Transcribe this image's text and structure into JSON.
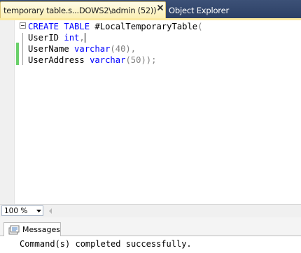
{
  "tabs": {
    "active_label": "temporary table.s...DOWS2\\admin (52))",
    "inactive_label": "Object Explorer"
  },
  "editor": {
    "lines": [
      [
        {
          "text": "CREATE TABLE",
          "kind": "keyword"
        },
        {
          "text": " #LocalTemporaryTable",
          "kind": "plain"
        },
        {
          "text": "(",
          "kind": "punct"
        }
      ],
      [
        {
          "text": "UserID ",
          "kind": "plain"
        },
        {
          "text": "int",
          "kind": "keyword"
        },
        {
          "text": ",",
          "kind": "punct"
        }
      ],
      [
        {
          "text": "UserName ",
          "kind": "plain"
        },
        {
          "text": "varchar",
          "kind": "keyword"
        },
        {
          "text": "(40),",
          "kind": "punct"
        }
      ],
      [
        {
          "text": "UserAddress ",
          "kind": "plain"
        },
        {
          "text": "varchar",
          "kind": "keyword"
        },
        {
          "text": "(50));",
          "kind": "punct"
        }
      ]
    ],
    "colors": {
      "keyword": "#0000ff",
      "punct": "#808080",
      "change_marker": "#6ad06a"
    }
  },
  "zoom": {
    "value": "100 %"
  },
  "results": {
    "tab_label": "Messages",
    "message": "Command(s) completed successfully."
  }
}
